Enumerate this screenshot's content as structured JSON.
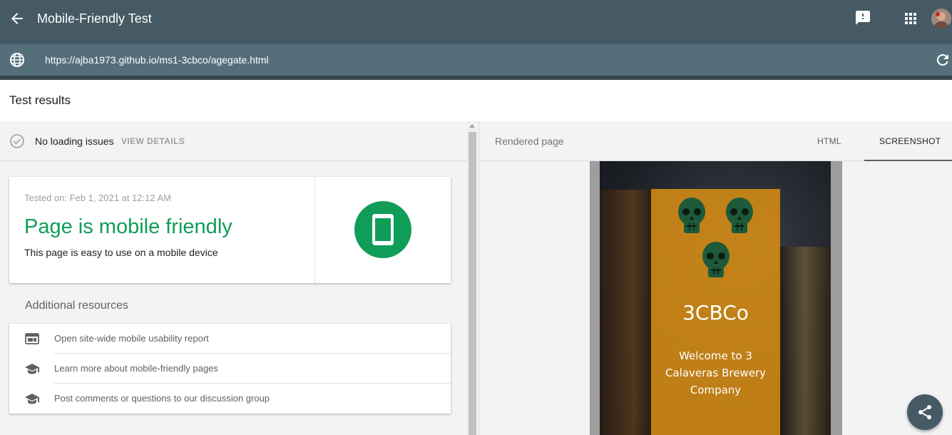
{
  "app": {
    "title": "Mobile-Friendly Test",
    "icons": [
      "back-arrow-icon",
      "feedback-icon",
      "apps-grid-icon",
      "avatar"
    ]
  },
  "urlbar": {
    "url": "https://ajba1973.github.io/ms1-3cbco/agegate.html",
    "icons": [
      "globe-icon",
      "refresh-icon"
    ]
  },
  "results": {
    "heading": "Test results"
  },
  "status": {
    "text": "No loading issues",
    "action": "VIEW DETAILS"
  },
  "result_card": {
    "tested_on": "Tested on: Feb 1, 2021 at 12:12 AM",
    "headline": "Page is mobile friendly",
    "subline": "This page is easy to use on a mobile device"
  },
  "resources": {
    "title": "Additional resources",
    "items": [
      {
        "label": "Open site-wide mobile usability report",
        "icon": "web-report-icon"
      },
      {
        "label": "Learn more about mobile-friendly pages",
        "icon": "school-icon"
      },
      {
        "label": "Post comments or questions to our discussion group",
        "icon": "school-icon"
      }
    ]
  },
  "rendered": {
    "label": "Rendered page",
    "tabs": [
      "HTML",
      "SCREENSHOT"
    ],
    "active_tab": "SCREENSHOT",
    "screenshot": {
      "brand": "3CBCo",
      "welcome": "Welcome to 3 Calaveras Brewery Company"
    }
  },
  "colors": {
    "appbar": "#455a64",
    "urlbar": "#546e7a",
    "success": "#0f9d58",
    "panel_orange": "#d68c14"
  }
}
